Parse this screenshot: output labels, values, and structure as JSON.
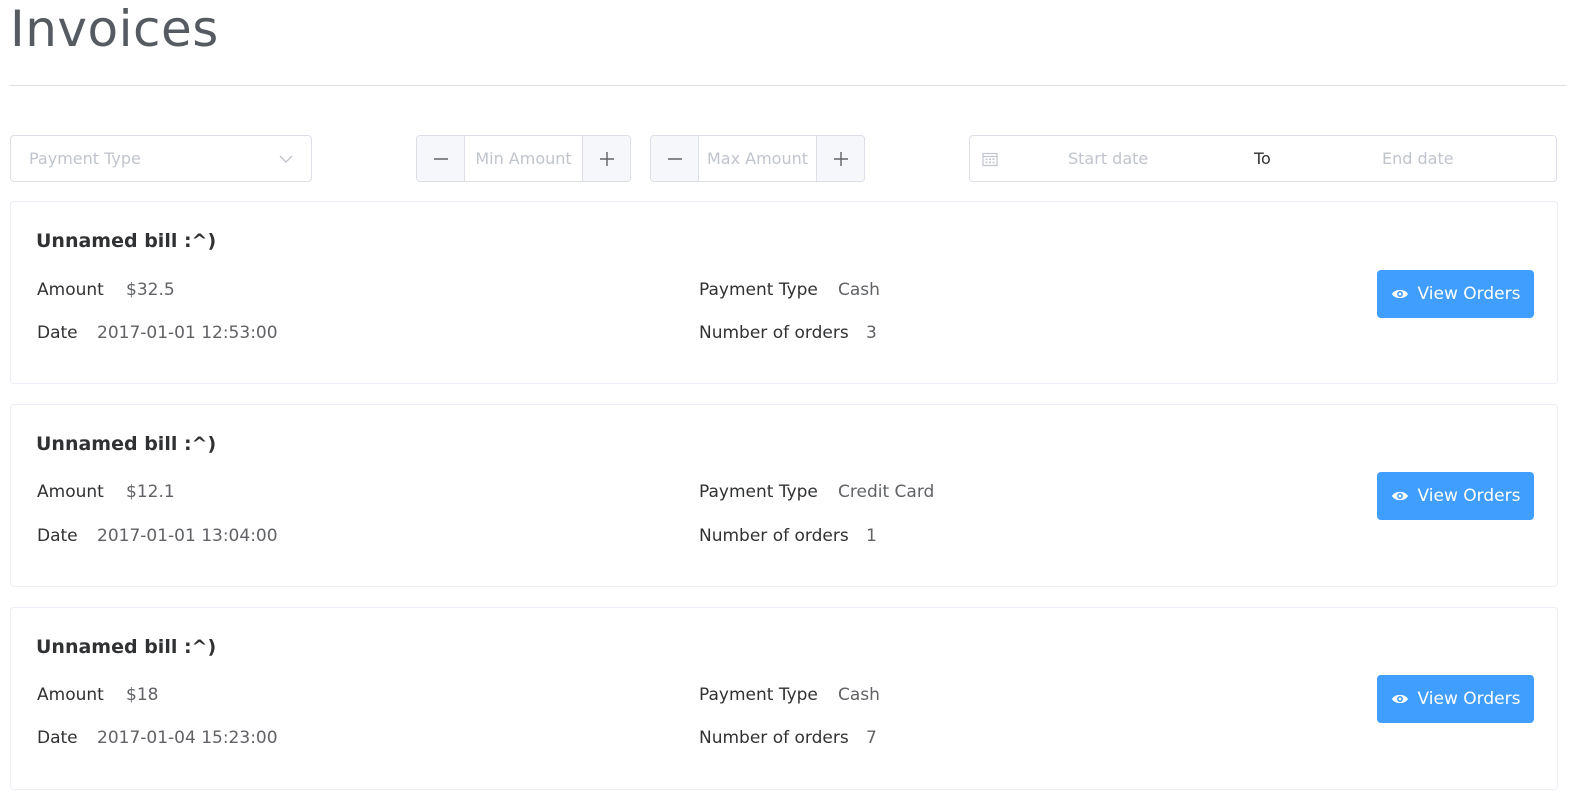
{
  "page": {
    "title": "Invoices"
  },
  "filters": {
    "payment_type_placeholder": "Payment Type",
    "min_amount_placeholder": "Min Amount",
    "max_amount_placeholder": "Max Amount",
    "start_date_placeholder": "Start date",
    "range_separator": "To",
    "end_date_placeholder": "End date"
  },
  "labels": {
    "amount": "Amount",
    "date": "Date",
    "payment_type": "Payment Type",
    "number_of_orders": "Number of orders",
    "view_orders": "View Orders"
  },
  "invoices": [
    {
      "title": "Unnamed bill :^)",
      "amount": "$32.5",
      "date": "2017-01-01 12:53:00",
      "payment_type": "Cash",
      "orders": "3"
    },
    {
      "title": "Unnamed bill :^)",
      "amount": "$12.1",
      "date": "2017-01-01 13:04:00",
      "payment_type": "Credit Card",
      "orders": "1"
    },
    {
      "title": "Unnamed bill :^)",
      "amount": "$18",
      "date": "2017-01-04 15:23:00",
      "payment_type": "Cash",
      "orders": "7"
    }
  ],
  "colors": {
    "primary": "#409eff",
    "border": "#dcdfe6",
    "placeholder": "#c0c4cc"
  },
  "icons": {
    "select": "chevron-down-icon",
    "decrease": "minus-icon",
    "increase": "plus-icon",
    "date": "calendar-icon",
    "view": "eye-icon"
  }
}
